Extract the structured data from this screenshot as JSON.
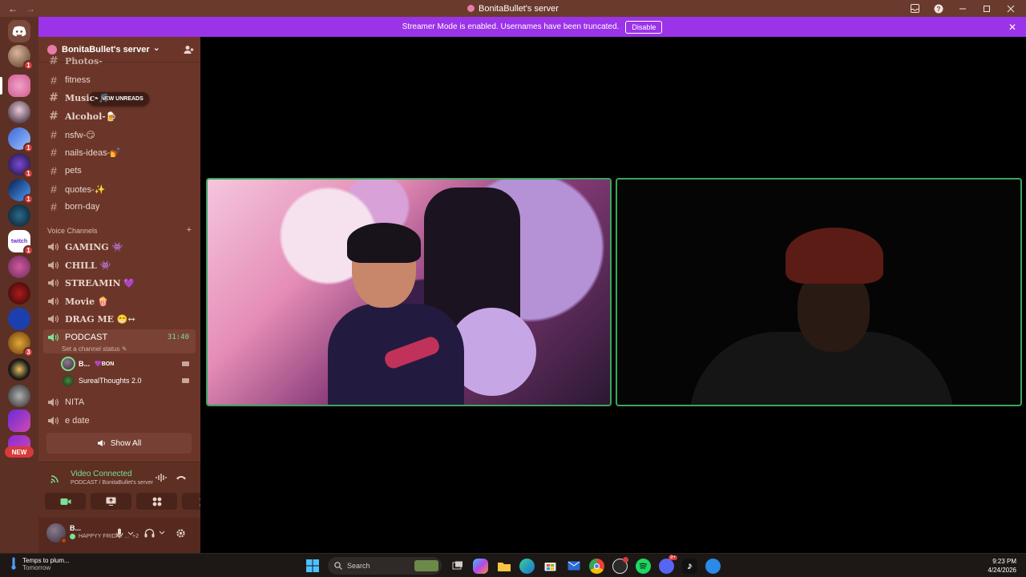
{
  "window": {
    "title": "BonitaBullet's server",
    "back_glyph": "←",
    "forward_glyph": "→"
  },
  "banner": {
    "message": "Streamer Mode is enabled. Usernames have been truncated.",
    "disable_label": "Disable",
    "close_glyph": "✕",
    "color": "#9b33e8"
  },
  "server": {
    "name": "BonitaBullet's server",
    "chevron": "⌄"
  },
  "new_unreads_label": "NEW UNREADS",
  "text_channels": [
    {
      "name": "Photos-",
      "style": "serif"
    },
    {
      "name": "fitness",
      "style": "sans"
    },
    {
      "name": "Music-🎵",
      "style": "serif"
    },
    {
      "name": "Alcohol-🍺",
      "style": "serif"
    },
    {
      "name": "nsfw-😏",
      "style": "sans"
    },
    {
      "name": "nails-ideas-💅",
      "style": "sans"
    },
    {
      "name": "pets",
      "style": "sans"
    },
    {
      "name": "quotes-✨",
      "style": "sans"
    },
    {
      "name": "born-day",
      "style": "sans"
    }
  ],
  "voice_category": {
    "label": "Voice Channels",
    "add_glyph": "+"
  },
  "voice_channels": [
    {
      "name": "GAMING 👾",
      "style": "serif"
    },
    {
      "name": "CHILL 👾",
      "style": "serif"
    },
    {
      "name": "STREAMIN 💜",
      "style": "serif"
    },
    {
      "name": "Movie 🍿",
      "style": "serif"
    },
    {
      "name": "DRAG ME 😁↔",
      "style": "serif"
    },
    {
      "name": "PODCAST",
      "style": "sans",
      "timer": "31:40",
      "status_hint": "Set a channel status ✎"
    },
    {
      "name": "NITA",
      "style": "sans"
    },
    {
      "name": "e date",
      "style": "sans"
    }
  ],
  "podcast_members": [
    {
      "name": "B...",
      "tag": "💜BON"
    },
    {
      "name": "SurealThoughts 2.0",
      "tag": ""
    }
  ],
  "show_all_label": "Show All",
  "voice_panel": {
    "status": "Video Connected",
    "location": "PODCAST / BonitaBullet's server",
    "accent": "#7ddf97"
  },
  "user_panel": {
    "name": "B...",
    "status": "HAPPYY FRIDAY ...",
    "extra": "+2"
  },
  "server_badges": [
    "1",
    "1",
    "1",
    "1",
    "1",
    "1",
    "3"
  ],
  "new_pill_label": "NEW",
  "taskbar": {
    "weather_title": "Temps to plum...",
    "weather_sub": "Tomorrow",
    "search_label": "Search",
    "time": "9:23 PM",
    "date": "4/24/2026"
  }
}
